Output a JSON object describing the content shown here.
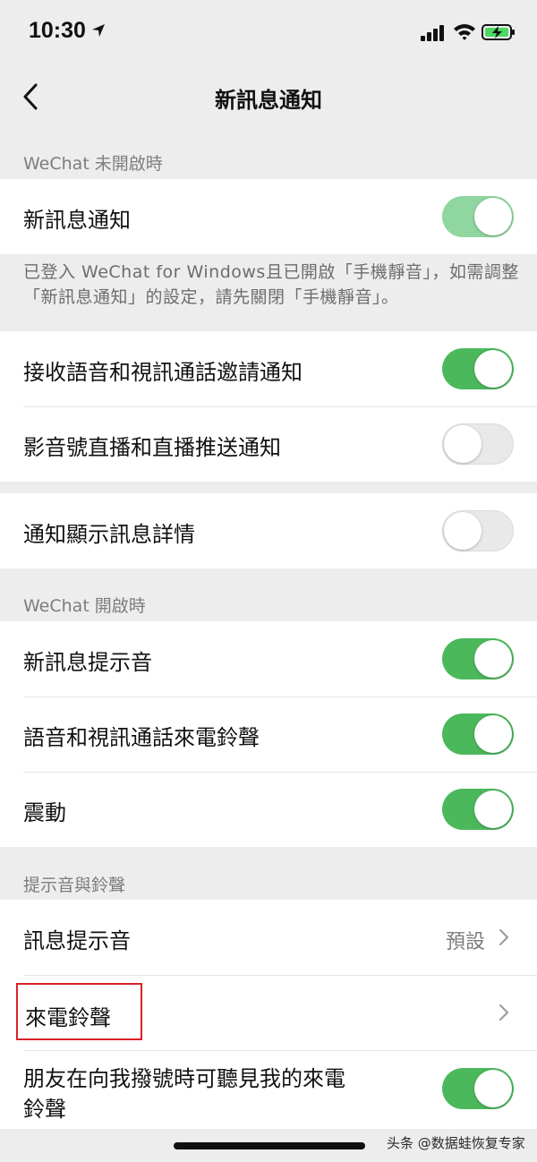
{
  "status": {
    "time": "10:30"
  },
  "nav": {
    "title": "新訊息通知"
  },
  "sections": {
    "closed_header": "WeChat 未開啟時",
    "open_header": "WeChat 開啟時",
    "sound_header": "提示音與鈴聲"
  },
  "rows": {
    "new_msg": {
      "label": "新訊息通知",
      "on": true
    },
    "note": "已登入 WeChat for Windows且已開啟「手機靜音」，如需調整「新訊息通知」的設定，請先關閉「手機靜音」。",
    "call_invite": {
      "label": "接收語音和視訊通話邀請通知",
      "on": true
    },
    "live_push": {
      "label": "影音號直播和直播推送通知",
      "on": false
    },
    "show_detail": {
      "label": "通知顯示訊息詳情",
      "on": false
    },
    "msg_sound": {
      "label": "新訊息提示音",
      "on": true
    },
    "call_ring": {
      "label": "語音和視訊通話來電鈴聲",
      "on": true
    },
    "vibrate": {
      "label": "震動",
      "on": true
    },
    "msg_tone": {
      "label": "訊息提示音",
      "value": "預設"
    },
    "ringtone": {
      "label": "來電鈴聲"
    },
    "friends_hear": {
      "label_line1": "朋友在向我撥號時可聽見我的來電",
      "label_line2": "鈴聲",
      "on": true
    }
  },
  "watermark": "头条 @数据蛙恢复专家",
  "colors": {
    "toggle_on": "#4cb85c",
    "background": "#ededed",
    "highlight_box": "#d9222a"
  }
}
